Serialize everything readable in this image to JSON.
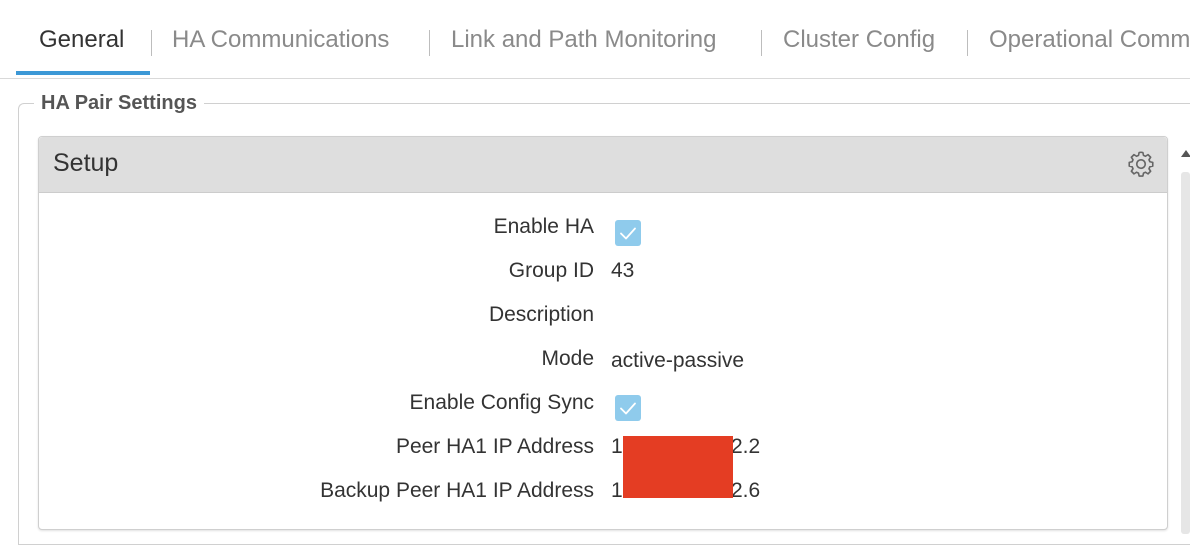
{
  "tabs": [
    {
      "label": "General",
      "active": true
    },
    {
      "label": "HA Communications"
    },
    {
      "label": "Link and Path Monitoring"
    },
    {
      "label": "Cluster Config"
    },
    {
      "label": "Operational Comm"
    }
  ],
  "section": {
    "legend": "HA Pair Settings"
  },
  "panel": {
    "title": "Setup",
    "settings_icon": "gear-icon",
    "fields": {
      "enable_ha": {
        "label": "Enable HA",
        "checked": true
      },
      "group_id": {
        "label": "Group ID",
        "value": "43"
      },
      "description": {
        "label": "Description",
        "value": ""
      },
      "mode": {
        "label": "Mode",
        "value": "active-passive"
      },
      "enable_config_sync": {
        "label": "Enable Config Sync",
        "checked": true
      },
      "peer_ha1_ip": {
        "label": "Peer HA1 IP Address",
        "value_prefix": "1",
        "value_suffix": "2.2"
      },
      "backup_peer_ha1_ip": {
        "label": "Backup Peer HA1 IP Address",
        "value_prefix": "1",
        "value_suffix": "2.6"
      }
    }
  },
  "colors": {
    "active_tab_underline": "#3c98d6",
    "checkbox": "#8fcbec",
    "redaction": "#e43d23",
    "panel_header": "#dedede"
  }
}
